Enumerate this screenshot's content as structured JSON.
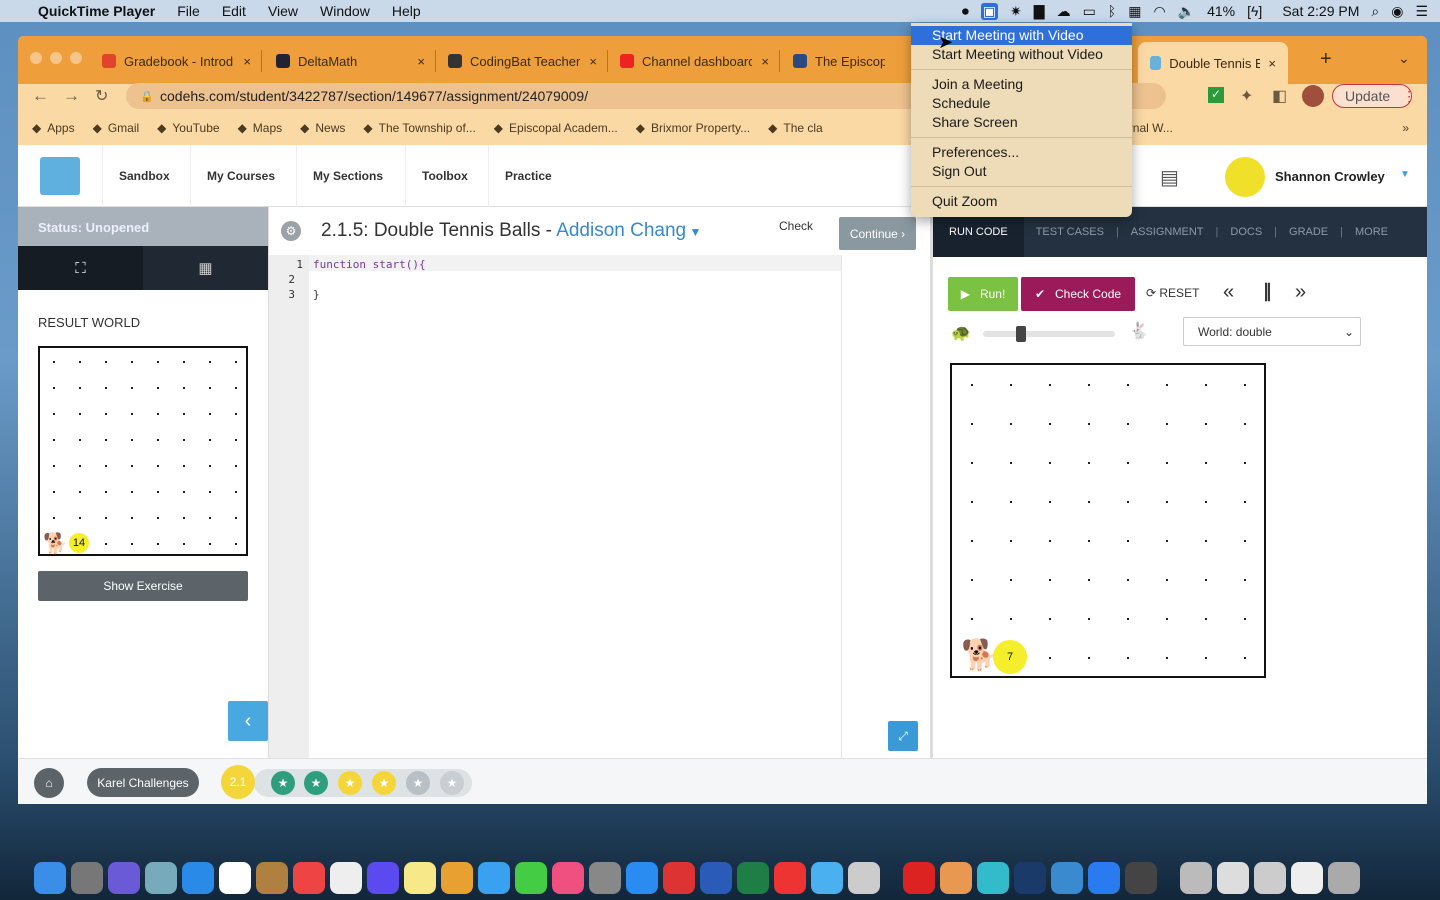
{
  "menubar": {
    "app": "QuickTime Player",
    "items": [
      "File",
      "Edit",
      "View",
      "Window",
      "Help"
    ],
    "battery": "41%",
    "clock": "Sat 2:29 PM"
  },
  "browser": {
    "tabs": [
      {
        "label": "Gradebook - Introd",
        "color": "#e0442a"
      },
      {
        "label": "DeltaMath",
        "color": "#223"
      },
      {
        "label": "CodingBat Teacher",
        "color": "#333"
      },
      {
        "label": "Channel dashboard",
        "color": "#e22"
      },
      {
        "label": "The Episcopal A",
        "color": "#2a4a80"
      },
      {
        "label": "Double Tennis Balls",
        "color": "#6ab0d8"
      }
    ],
    "url": "codehs.com/student/3422787/section/149677/assignment/24079009/",
    "update_label": "Update",
    "bookmarks": [
      "Apps",
      "Gmail",
      "YouTube",
      "Maps",
      "News",
      "The Township of...",
      "Episcopal Academ...",
      "Brixmor Property...",
      "The cla",
      "Medical Journal W..."
    ],
    "bookmarks_more": "»"
  },
  "nav": {
    "items": [
      "Sandbox",
      "My Courses",
      "My Sections",
      "Toolbox",
      "Practice"
    ],
    "user": "Shannon Crowley"
  },
  "left": {
    "status": "Status: Unopened",
    "result_world_label": "RESULT WORLD",
    "ball_count": "14",
    "show_exercise": "Show Exercise"
  },
  "editor": {
    "title": "2.1.5: Double Tennis Balls - ",
    "student": "Addison Chang",
    "check_label": "Check",
    "continue_label": "Continue ›",
    "lines": [
      "1",
      "2",
      "3"
    ],
    "code": [
      "function start(){",
      "",
      "}"
    ]
  },
  "right": {
    "tabs": [
      "RUN CODE",
      "TEST CASES",
      "ASSIGNMENT",
      "DOCS",
      "GRADE",
      "MORE"
    ],
    "run_label": "Run!",
    "check_code_label": "Check Code",
    "reset_label": "RESET",
    "world_select": "World: double",
    "speed": 0.25,
    "ball_count": "7"
  },
  "bottom": {
    "breadcrumb": "Karel Challenges",
    "lesson": "2.1",
    "stars": [
      {
        "state": "complete",
        "color": "#2e9e7e"
      },
      {
        "state": "complete",
        "color": "#2e9e7e"
      },
      {
        "state": "in-progress",
        "color": "#f5d63a"
      },
      {
        "state": "in-progress",
        "color": "#f5d63a"
      },
      {
        "state": "unopened",
        "color": "#b8c0c6"
      },
      {
        "state": "unopened",
        "color": "#c8ced2"
      }
    ]
  },
  "zoom_menu": {
    "items": [
      "Start Meeting with Video",
      "Start Meeting without Video",
      "Join a Meeting",
      "Schedule",
      "Share Screen",
      "Preferences...",
      "Sign Out",
      "Quit Zoom"
    ]
  },
  "dock": {
    "colors": [
      "#3b8ee8",
      "#777",
      "#6a5ad8",
      "#7ab",
      "#2a8ae8",
      "#fff",
      "#b08040",
      "#e44",
      "#eee",
      "#5a4af0",
      "#f7e98a",
      "#e8a030",
      "#3aa0f0",
      "#4c4",
      "#f05080",
      "#888",
      "#2a8cf0",
      "#d33",
      "#2a5bb8",
      "#1e7e45",
      "#e33",
      "#4ab0f0",
      "#ccc",
      "#d22",
      "#e89850",
      "#3bc",
      "#1a3a6a",
      "#3a8ad0",
      "#2a7af0",
      "#444",
      "#bbb",
      "#ddd",
      "#ccc",
      "#eee",
      "#aaa"
    ]
  }
}
